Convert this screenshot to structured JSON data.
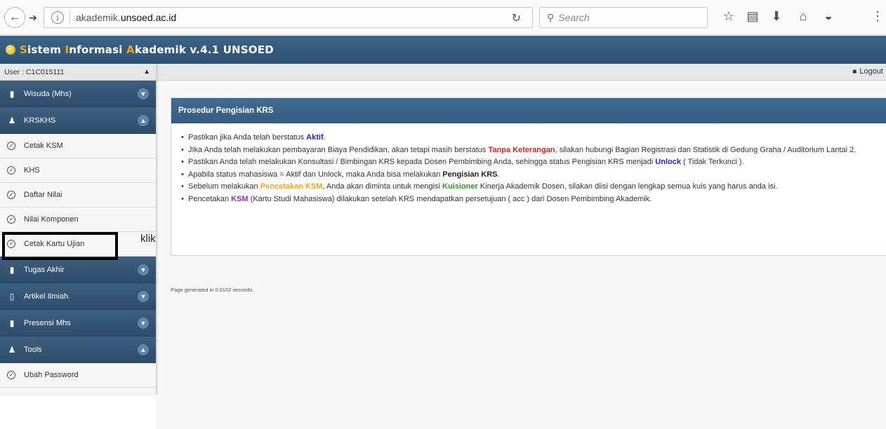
{
  "browser": {
    "url_prefix": "akademik.",
    "url_domain": "unsoed.ac.id",
    "search_placeholder": "Search"
  },
  "app": {
    "title_parts": [
      "S",
      "istem ",
      "I",
      "nformasi ",
      "A",
      "kademik v.4.1 UNSOED"
    ],
    "accent_color": "#f6a21a",
    "header_color": "#34597c"
  },
  "sidebar": {
    "user_label": "User : C1C015111",
    "groups": [
      {
        "label": "Wisuda (Mhs)",
        "icon": "bookmark-icon",
        "expanded": false
      },
      {
        "label": "KRSKHS",
        "icon": "users-icon",
        "expanded": true,
        "items": [
          "Cetak KSM",
          "KHS",
          "Daftar Nilai",
          "Nilai Komponen",
          "Cetak Kartu Ujian"
        ]
      },
      {
        "label": "Tugas Akhir",
        "icon": "bookmark-icon",
        "expanded": false
      },
      {
        "label": "Artikel Ilmiah.",
        "icon": "file-icon",
        "expanded": false
      },
      {
        "label": "Presensi Mhs",
        "icon": "bookmark-icon",
        "expanded": false
      },
      {
        "label": "Tools",
        "icon": "users-icon",
        "expanded": true,
        "items": [
          "Ubah Password"
        ]
      }
    ]
  },
  "annotation": {
    "klik": "klik"
  },
  "topbar": {
    "logout_label": "Logout"
  },
  "panel": {
    "title": "Prosedur Pengisian KRS",
    "items": [
      {
        "parts": [
          {
            "t": "Pastikan jika Anda telah berstatus "
          },
          {
            "t": "Aktif",
            "c": "t-blue"
          },
          {
            "t": "."
          }
        ]
      },
      {
        "parts": [
          {
            "t": "JIka Anda telah melakukan pembayaran Biaya Pendidikan, akan tetapi masih berstatus "
          },
          {
            "t": "Tanpa Keterangan",
            "c": "t-red"
          },
          {
            "t": ", silakan hubungi Bagian Registrasi dan Statistik di Gedung Graha / Auditorium Lantai 2."
          }
        ]
      },
      {
        "parts": [
          {
            "t": "Pastikan Anda telah melakukan Konsultasi / Bimbingan KRS kepada Dosen Pembimbing Anda, sehingga status Pengisian KRS menjadi "
          },
          {
            "t": "Unlock",
            "c": "t-blue"
          },
          {
            "t": " ( Tidak Terkunci )."
          }
        ]
      },
      {
        "parts": [
          {
            "t": "Apabila status mahasiswa = Aktif dan Unlock, maka Anda bisa melakukan "
          },
          {
            "t": "Pengisian KRS",
            "c": "t-bold"
          },
          {
            "t": "."
          }
        ]
      },
      {
        "parts": [
          {
            "t": "Sebelum melakukan "
          },
          {
            "t": "Pencetakan KSM",
            "c": "t-orange"
          },
          {
            "t": ", Anda akan diminta untuk mengisi "
          },
          {
            "t": "Kuisioner",
            "c": "t-green"
          },
          {
            "t": " Kinerja Akademik Dosen, silakan diisi dengan lengkap semua kuis yang harus anda isi."
          }
        ]
      },
      {
        "parts": [
          {
            "t": "Pencetakan "
          },
          {
            "t": "KSM",
            "c": "t-purple"
          },
          {
            "t": " (Kartu Studi Mahasiswa) dilakukan setelah KRS mendapatkan persetujuan ( acc ) dari Dosen Pembimbing Akademik."
          }
        ]
      }
    ]
  },
  "footer": {
    "page_generated": "Page generated in 0.0102 seconds."
  }
}
